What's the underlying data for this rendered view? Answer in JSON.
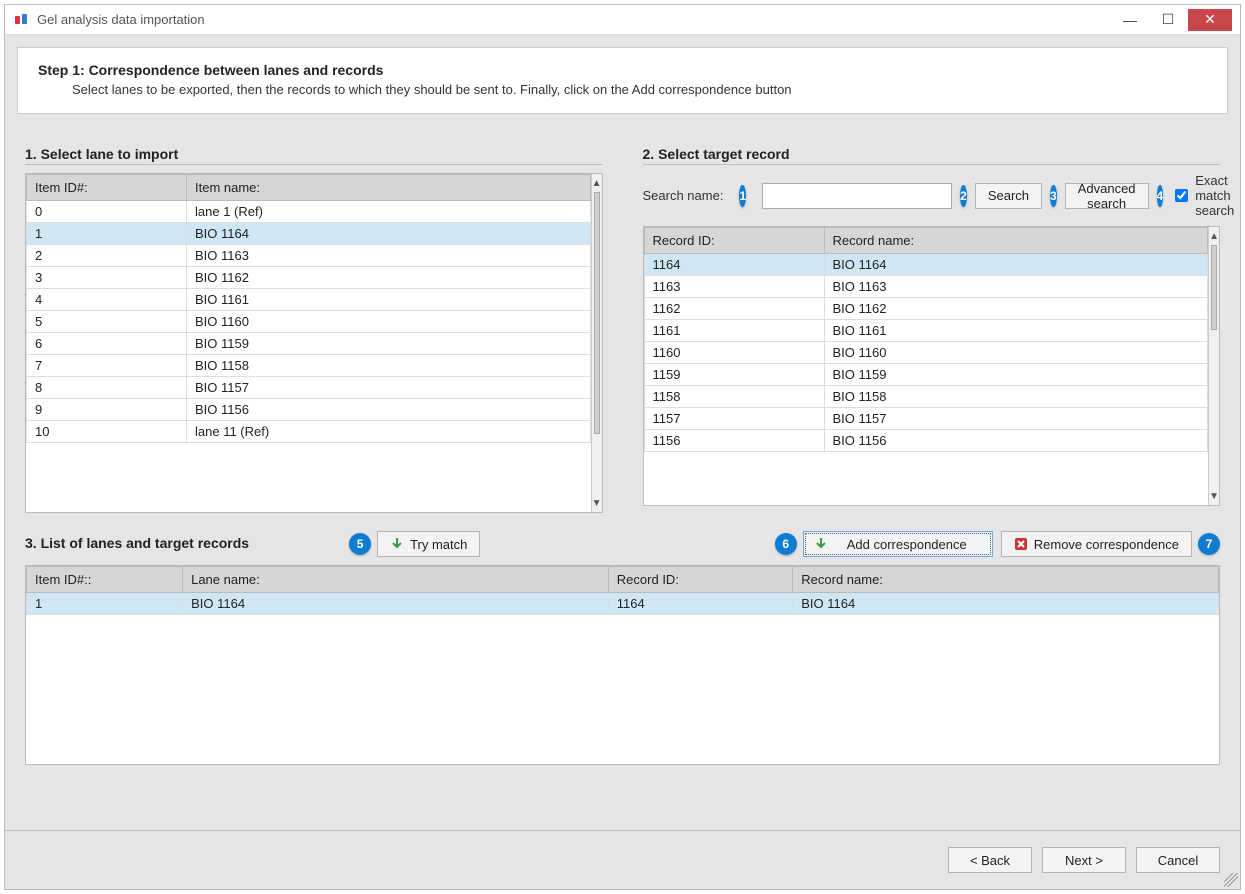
{
  "window": {
    "title": "Gel analysis data importation"
  },
  "header": {
    "step_title": "Step 1: Correspondence between lanes and records",
    "description": "Select lanes to be exported, then the records to which they should be sent to. Finally, click on the Add correspondence button"
  },
  "annotations": [
    "1",
    "2",
    "3",
    "4",
    "5",
    "6",
    "7"
  ],
  "lanes": {
    "title": "1. Select lane to import",
    "col_id": "Item ID#:",
    "col_name": "Item name:",
    "selected_index": 1,
    "rows": [
      {
        "id": "0",
        "name": "lane 1 (Ref)"
      },
      {
        "id": "1",
        "name": "BIO 1164"
      },
      {
        "id": "2",
        "name": "BIO 1163"
      },
      {
        "id": "3",
        "name": "BIO 1162"
      },
      {
        "id": "4",
        "name": "BIO 1161"
      },
      {
        "id": "5",
        "name": "BIO 1160"
      },
      {
        "id": "6",
        "name": "BIO 1159"
      },
      {
        "id": "7",
        "name": "BIO 1158"
      },
      {
        "id": "8",
        "name": "BIO 1157"
      },
      {
        "id": "9",
        "name": "BIO 1156"
      },
      {
        "id": "10",
        "name": "lane 11 (Ref)"
      }
    ]
  },
  "records": {
    "title": "2. Select target record",
    "search_label": "Search name:",
    "search_value": "",
    "search_btn": "Search",
    "advanced_btn": "Advanced search",
    "exact_label": "Exact match search",
    "exact_checked": true,
    "col_id": "Record ID:",
    "col_name": "Record name:",
    "selected_index": 0,
    "rows": [
      {
        "id": "1164",
        "name": "BIO 1164"
      },
      {
        "id": "1163",
        "name": "BIO 1163"
      },
      {
        "id": "1162",
        "name": "BIO 1162"
      },
      {
        "id": "1161",
        "name": "BIO 1161"
      },
      {
        "id": "1160",
        "name": "BIO 1160"
      },
      {
        "id": "1159",
        "name": "BIO 1159"
      },
      {
        "id": "1158",
        "name": "BIO 1158"
      },
      {
        "id": "1157",
        "name": "BIO 1157"
      },
      {
        "id": "1156",
        "name": "BIO 1156"
      }
    ]
  },
  "mid": {
    "title": "3. List of lanes and target records",
    "try_match": "Try match",
    "add_corr": "Add correspondence",
    "remove_corr": "Remove correspondence"
  },
  "corr": {
    "col1": "Item ID#::",
    "col2": "Lane name:",
    "col3": "Record ID:",
    "col4": "Record name:",
    "rows": [
      {
        "item": "1",
        "lane": "BIO 1164",
        "recid": "1164",
        "recname": "BIO 1164"
      }
    ]
  },
  "footer": {
    "back": "< Back",
    "next": "Next >",
    "cancel": "Cancel"
  }
}
